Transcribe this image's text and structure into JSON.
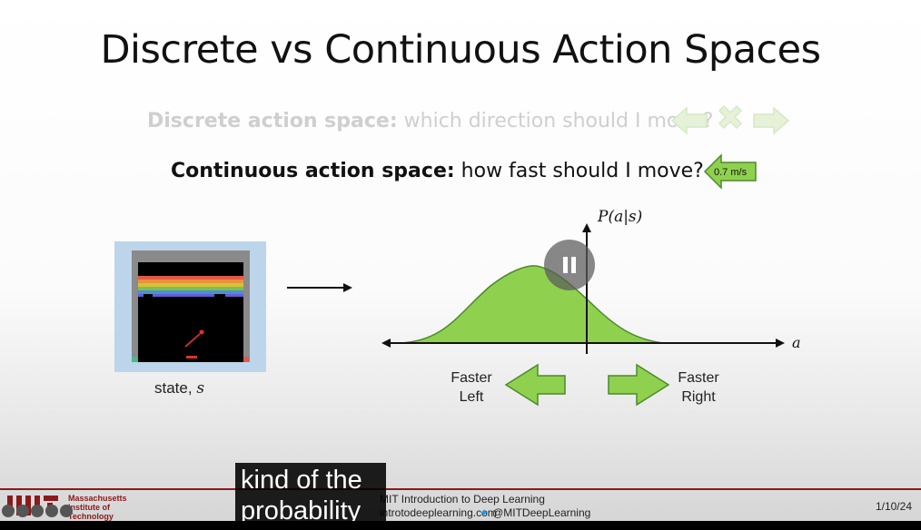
{
  "slide": {
    "title": "Discrete vs Continuous Action Spaces",
    "discrete": {
      "label": "Discrete action space:",
      "question": "which direction should I move?"
    },
    "continuous": {
      "label": "Continuous action space:",
      "question": "how fast should I move?",
      "speed_badge": "0.7 m/s"
    },
    "state_label": "state, ",
    "state_symbol": "s",
    "chart_ylabel": "P(a|s)",
    "chart_xlabel": "a",
    "faster_left": [
      "Faster",
      "Left"
    ],
    "faster_right": [
      "Faster",
      "Right"
    ]
  },
  "footer": {
    "institution": [
      "Massachusetts",
      "Institute of",
      "Technology"
    ],
    "course": "MIT Introduction to Deep Learning",
    "site": "introtodeeplearning.com",
    "twitter": "@MITDeepLearning",
    "date": "1/10/24"
  },
  "caption": [
    "kind of the",
    "probability"
  ],
  "colors": {
    "green_fill": "#8fd14f",
    "green_stroke": "#4c8a2a",
    "arrow_green": "#8fd14f",
    "mit_red": "#8b1a1a"
  },
  "icons": [
    "pause-icon",
    "left-arrow-icon",
    "x-icon",
    "right-arrow-icon",
    "twitter-icon"
  ]
}
